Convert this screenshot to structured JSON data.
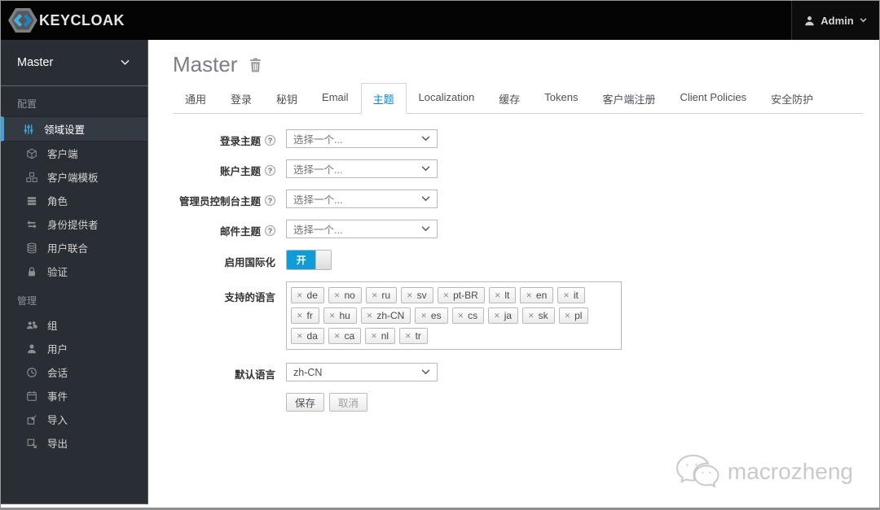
{
  "topbar": {
    "brand": "KEYCLOAK",
    "user": {
      "label": "Admin"
    }
  },
  "sidebar": {
    "realm": "Master",
    "sections": [
      {
        "label": "配置",
        "items": [
          {
            "label": "领域设置"
          },
          {
            "label": "客户端"
          },
          {
            "label": "客户端模板"
          },
          {
            "label": "角色"
          },
          {
            "label": "身份提供者"
          },
          {
            "label": "用户联合"
          },
          {
            "label": "验证"
          }
        ]
      },
      {
        "label": "管理",
        "items": [
          {
            "label": "组"
          },
          {
            "label": "用户"
          },
          {
            "label": "会话"
          },
          {
            "label": "事件"
          },
          {
            "label": "导入"
          },
          {
            "label": "导出"
          }
        ]
      }
    ]
  },
  "main": {
    "title": "Master",
    "tabs": [
      {
        "label": "通用"
      },
      {
        "label": "登录"
      },
      {
        "label": "秘钥"
      },
      {
        "label": "Email"
      },
      {
        "label": "主题",
        "active": true
      },
      {
        "label": "Localization"
      },
      {
        "label": "缓存"
      },
      {
        "label": "Tokens"
      },
      {
        "label": "客户端注册"
      },
      {
        "label": "Client Policies"
      },
      {
        "label": "安全防护"
      }
    ],
    "form": {
      "theme_fields": [
        {
          "label": "登录主题",
          "value": "选择一个..."
        },
        {
          "label": "账户主题",
          "value": "选择一个..."
        },
        {
          "label": "管理员控制台主题",
          "value": "选择一个..."
        },
        {
          "label": "邮件主题",
          "value": "选择一个..."
        }
      ],
      "i18n": {
        "label": "启用国际化",
        "state": "开"
      },
      "locales": {
        "label": "支持的语言",
        "tags": [
          "de",
          "no",
          "ru",
          "sv",
          "pt-BR",
          "lt",
          "en",
          "it",
          "fr",
          "hu",
          "zh-CN",
          "es",
          "cs",
          "ja",
          "sk",
          "pl",
          "da",
          "ca",
          "nl",
          "tr"
        ]
      },
      "default_locale": {
        "label": "默认语言",
        "value": "zh-CN"
      },
      "actions": {
        "save": "保存",
        "cancel": "取消"
      }
    }
  },
  "watermark": {
    "text": "macrozheng"
  },
  "icons": {
    "remove": "✕",
    "help": "?"
  },
  "colors": {
    "accent_blue": "#39a5dc",
    "tab_active_blue": "#0088ce",
    "toggle_on_blue": "#0f9dd9",
    "topbar_bg": "#040404",
    "sidebar_bg": "#292e34"
  }
}
